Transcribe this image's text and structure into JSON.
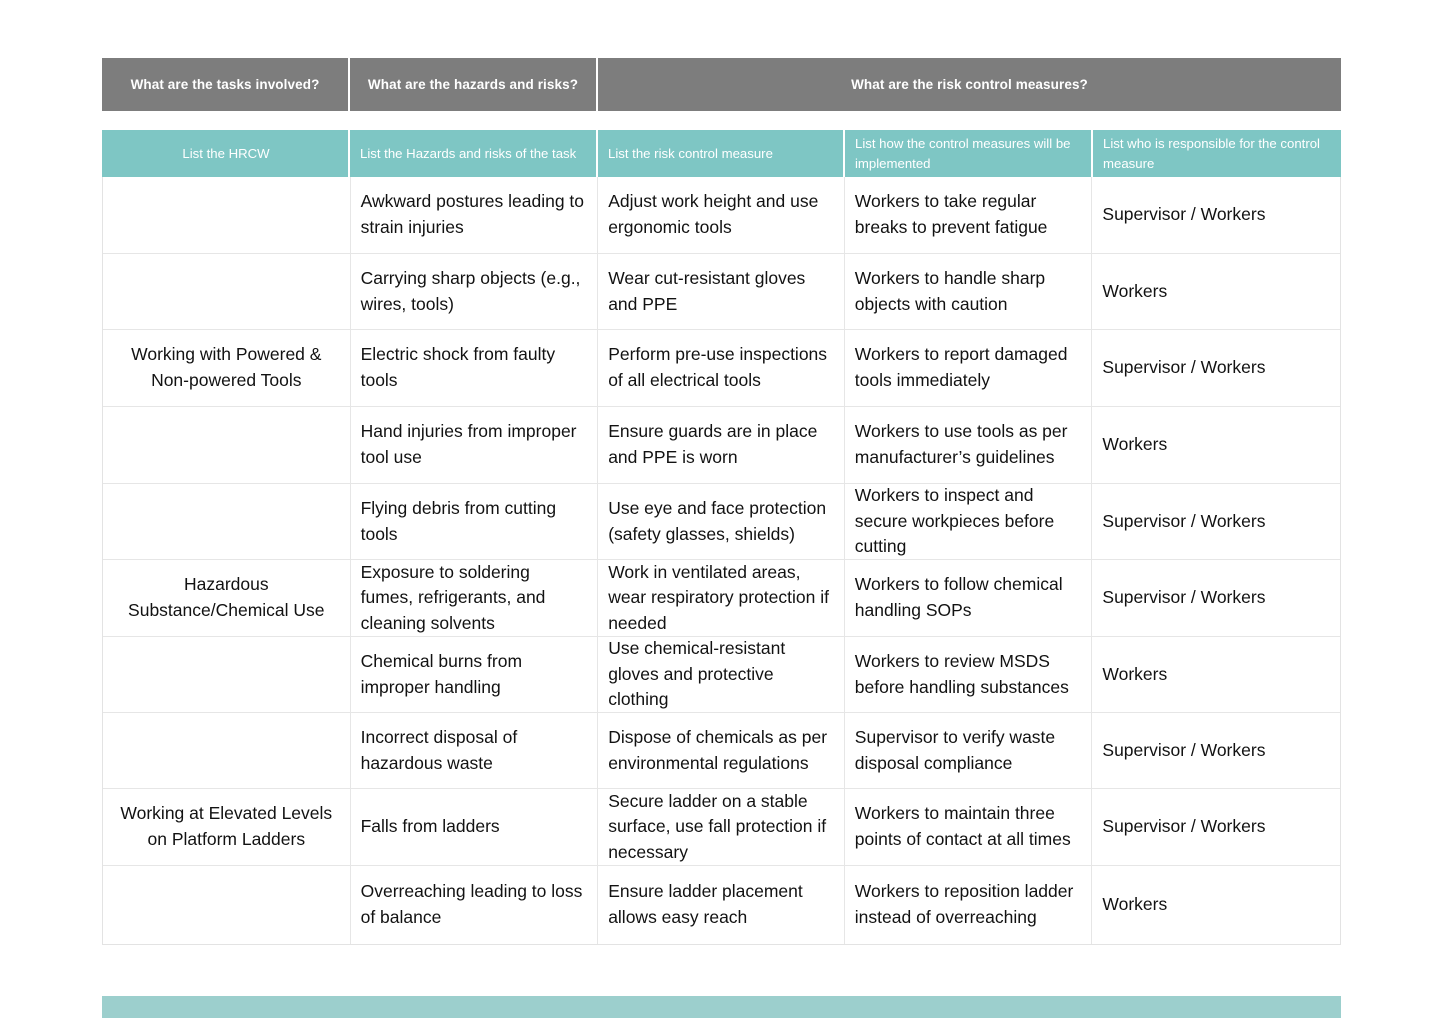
{
  "group_headers": [
    {
      "label": "What are the tasks involved?"
    },
    {
      "label": "What are the hazards and risks?"
    },
    {
      "label": "What are the risk control measures?"
    }
  ],
  "column_headers": [
    {
      "label": "List the HRCW"
    },
    {
      "label": "List the Hazards and risks of the task"
    },
    {
      "label": "List the risk control measure"
    },
    {
      "label": "List how the control measures will be implemented"
    },
    {
      "label": "List who is responsible for the control measure"
    }
  ],
  "colors": {
    "group_header_bg": "#7d7d7d",
    "column_header_bg": "#7ec6c4",
    "bottom_bar_bg": "#9ccfcd",
    "grid_line": "#e6e6e6",
    "text": "#121212",
    "header_text": "#ffffff"
  },
  "rows": [
    {
      "task": "",
      "hazard": "Awkward postures leading to strain injuries",
      "control": "Adjust work height and use ergonomic tools",
      "implementation": "Workers to take regular breaks to prevent fatigue",
      "responsible": "Supervisor / Workers"
    },
    {
      "task": "",
      "hazard": "Carrying sharp objects (e.g., wires, tools)",
      "control": "Wear cut-resistant gloves and PPE",
      "implementation": "Workers to handle sharp objects with caution",
      "responsible": "Workers"
    },
    {
      "task": "Working with Powered & Non-powered Tools",
      "hazard": "Electric shock from faulty tools",
      "control": "Perform pre-use inspections of all electrical tools",
      "implementation": "Workers to report damaged tools immediately",
      "responsible": "Supervisor / Workers"
    },
    {
      "task": "",
      "hazard": "Hand injuries from improper tool use",
      "control": "Ensure guards are in place and PPE is worn",
      "implementation": "Workers to use tools as per manufacturer’s guidelines",
      "responsible": "Workers"
    },
    {
      "task": "",
      "hazard": "Flying debris from cutting tools",
      "control": "Use eye and face protection (safety glasses, shields)",
      "implementation": "Workers to inspect and secure workpieces before cutting",
      "responsible": "Supervisor / Workers"
    },
    {
      "task": "Hazardous Substance/Chemical Use",
      "hazard": "Exposure to soldering fumes, refrigerants, and cleaning solvents",
      "control": "Work in ventilated areas, wear respiratory protection if needed",
      "implementation": "Workers to follow chemical handling SOPs",
      "responsible": "Supervisor / Workers"
    },
    {
      "task": "",
      "hazard": "Chemical burns from improper handling",
      "control": "Use chemical-resistant gloves and protective clothing",
      "implementation": "Workers to review MSDS before handling substances",
      "responsible": "Workers"
    },
    {
      "task": "",
      "hazard": "Incorrect disposal of hazardous waste",
      "control": "Dispose of chemicals as per environmental regulations",
      "implementation": "Supervisor to verify waste disposal compliance",
      "responsible": "Supervisor / Workers"
    },
    {
      "task": "Working at Elevated Levels on Platform Ladders",
      "hazard": "Falls from ladders",
      "control": "Secure ladder on a stable surface, use fall protection if necessary",
      "implementation": "Workers to maintain three points of contact at all times",
      "responsible": "Supervisor / Workers"
    },
    {
      "task": "",
      "hazard": "Overreaching leading to loss of balance",
      "control": "Ensure ladder placement allows easy reach",
      "implementation": "Workers to reposition ladder instead of overreaching",
      "responsible": "Workers"
    }
  ]
}
